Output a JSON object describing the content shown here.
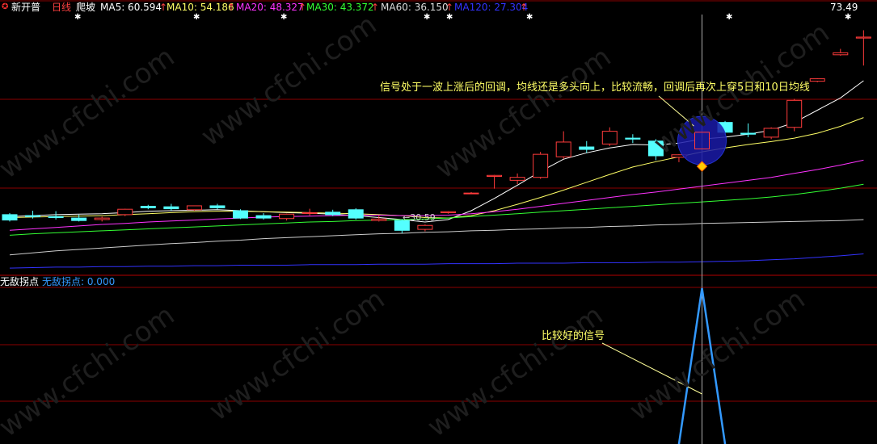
{
  "header": {
    "stock_name": "新开普",
    "period": "日线",
    "formula": "爬坡",
    "ma5": "MA5: 60.594",
    "ma10": "MA10: 54.186",
    "ma20": "MA20: 48.327",
    "ma30": "MA30: 43.372",
    "ma60": "MA60: 36.150",
    "ma120": "MA120: 27.304",
    "up_arrow": "↑",
    "price_label": "73.49"
  },
  "sub_header": {
    "indicator": "无敌拐点",
    "value_label": "无敌拐点: 0.000"
  },
  "annotations": {
    "main_note": "信号处于一波上涨后的回调，均线还是多头向上，比较流畅，回调后再次上穿5日和10日均线",
    "low_label": "←30.59",
    "sub_note": "比较好的信号"
  },
  "watermark": "www.cfchi.com",
  "colors": {
    "up": "#ff3b3b",
    "down": "#54ffff",
    "ma5": "#ffffff",
    "ma10": "#ffff66",
    "ma20": "#ff33ff",
    "ma30": "#33ff33",
    "ma60": "#cccccc",
    "ma120": "#3333ff",
    "signal": "#3399ff",
    "grid": "#8b0000"
  },
  "chart_data": {
    "type": "candlestick",
    "candles": [
      {
        "o": 37.2,
        "c": 36.1,
        "h": 37.5,
        "l": 35.8
      },
      {
        "o": 37.0,
        "c": 36.8,
        "h": 38.0,
        "l": 36.4
      },
      {
        "o": 36.8,
        "c": 36.6,
        "h": 37.9,
        "l": 36.2
      },
      {
        "o": 36.5,
        "c": 36.0,
        "h": 37.2,
        "l": 35.8
      },
      {
        "o": 36.2,
        "c": 36.5,
        "h": 36.8,
        "l": 35.8
      },
      {
        "o": 37.2,
        "c": 38.3,
        "h": 38.4,
        "l": 36.9
      },
      {
        "o": 38.9,
        "c": 38.6,
        "h": 39.2,
        "l": 38.3
      },
      {
        "o": 38.8,
        "c": 38.4,
        "h": 39.4,
        "l": 38.0
      },
      {
        "o": 38.2,
        "c": 39.0,
        "h": 39.0,
        "l": 38.0
      },
      {
        "o": 39.0,
        "c": 38.6,
        "h": 39.4,
        "l": 38.3
      },
      {
        "o": 38.0,
        "c": 36.5,
        "h": 38.3,
        "l": 36.3
      },
      {
        "o": 37.0,
        "c": 36.5,
        "h": 37.5,
        "l": 36.2
      },
      {
        "o": 36.4,
        "c": 37.3,
        "h": 37.4,
        "l": 36.0
      },
      {
        "o": 37.6,
        "c": 37.6,
        "h": 38.4,
        "l": 37.0
      },
      {
        "o": 37.7,
        "c": 37.2,
        "h": 38.2,
        "l": 36.9
      },
      {
        "o": 38.2,
        "c": 36.5,
        "h": 38.5,
        "l": 36.2
      },
      {
        "o": 36.0,
        "c": 36.3,
        "h": 37.0,
        "l": 35.8
      },
      {
        "o": 36.0,
        "c": 34.0,
        "h": 36.3,
        "l": 33.4
      },
      {
        "o": 34.2,
        "c": 35.0,
        "h": 35.2,
        "l": 33.8
      },
      {
        "o": 37.6,
        "c": 37.8,
        "h": 37.9,
        "l": 37.4
      },
      {
        "o": 41.5,
        "c": 41.6,
        "h": 41.8,
        "l": 41.4
      },
      {
        "o": 45.0,
        "c": 45.2,
        "h": 45.3,
        "l": 42.5
      },
      {
        "o": 44.2,
        "c": 44.8,
        "h": 45.6,
        "l": 43.4
      },
      {
        "o": 44.8,
        "c": 49.5,
        "h": 50.0,
        "l": 44.5
      },
      {
        "o": 49.0,
        "c": 52.0,
        "h": 54.2,
        "l": 48.6
      },
      {
        "o": 51.0,
        "c": 50.5,
        "h": 52.2,
        "l": 49.8
      },
      {
        "o": 51.6,
        "c": 54.2,
        "h": 55.0,
        "l": 51.2
      },
      {
        "o": 52.8,
        "c": 52.6,
        "h": 53.6,
        "l": 51.8
      },
      {
        "o": 52.2,
        "c": 49.2,
        "h": 52.6,
        "l": 48.3
      },
      {
        "o": 48.9,
        "c": 49.4,
        "h": 49.5,
        "l": 47.9
      },
      {
        "o": 50.6,
        "c": 54.0,
        "h": 55.0,
        "l": 50.2
      },
      {
        "o": 56.0,
        "c": 54.0,
        "h": 56.3,
        "l": 53.5
      },
      {
        "o": 53.8,
        "c": 53.6,
        "h": 55.8,
        "l": 53.0
      },
      {
        "o": 53.0,
        "c": 54.8,
        "h": 55.0,
        "l": 52.6
      },
      {
        "o": 55.0,
        "c": 60.5,
        "h": 60.8,
        "l": 54.2
      },
      {
        "o": 64.4,
        "c": 64.9,
        "h": 65.0,
        "l": 64.2
      },
      {
        "o": 69.8,
        "c": 70.2,
        "h": 71.0,
        "l": 69.6
      },
      {
        "o": 73.2,
        "c": 73.4,
        "h": 74.8,
        "l": 67.6
      }
    ],
    "ma": {
      "MA5": [
        36.8,
        37.0,
        37.2,
        37.3,
        37.4,
        37.6,
        37.9,
        38.0,
        38.1,
        38.2,
        38.0,
        37.8,
        37.6,
        37.5,
        37.3,
        37.0,
        36.6,
        36.2,
        35.7,
        36.2,
        38.0,
        40.5,
        43.2,
        46.0,
        48.5,
        49.8,
        50.8,
        51.5,
        51.4,
        51.8,
        52.6,
        53.0,
        53.6,
        54.4,
        56.0,
        58.5,
        61.0,
        64.5
      ],
      "MA10": [
        36.6,
        36.7,
        36.8,
        36.9,
        37.0,
        37.2,
        37.4,
        37.6,
        37.8,
        37.9,
        37.9,
        37.8,
        37.7,
        37.6,
        37.5,
        37.4,
        37.2,
        37.0,
        36.6,
        36.5,
        37.0,
        38.0,
        39.3,
        40.7,
        42.2,
        43.8,
        45.4,
        46.9,
        48.0,
        49.0,
        50.0,
        50.8,
        51.5,
        52.1,
        52.8,
        53.8,
        55.2,
        57.0
      ],
      "MA20": [
        34.0,
        34.3,
        34.6,
        34.9,
        35.2,
        35.4,
        35.7,
        35.9,
        36.1,
        36.3,
        36.5,
        36.7,
        36.8,
        36.9,
        37.0,
        37.1,
        37.1,
        37.0,
        37.0,
        37.1,
        37.4,
        37.8,
        38.3,
        38.9,
        39.5,
        40.1,
        40.7,
        41.3,
        41.8,
        42.4,
        43.0,
        43.6,
        44.2,
        44.8,
        45.6,
        46.4,
        47.3,
        48.3
      ],
      "MA30": [
        33.0,
        33.3,
        33.5,
        33.7,
        33.9,
        34.1,
        34.3,
        34.5,
        34.7,
        34.9,
        35.1,
        35.3,
        35.5,
        35.7,
        35.8,
        36.0,
        36.1,
        36.2,
        36.3,
        36.5,
        36.8,
        37.1,
        37.4,
        37.7,
        38.0,
        38.3,
        38.6,
        38.9,
        39.2,
        39.5,
        39.8,
        40.1,
        40.4,
        40.8,
        41.3,
        41.9,
        42.6,
        43.4
      ],
      "MA60": [
        29.0,
        29.4,
        29.8,
        30.1,
        30.4,
        30.7,
        31.0,
        31.3,
        31.5,
        31.8,
        32.0,
        32.3,
        32.5,
        32.7,
        32.9,
        33.1,
        33.3,
        33.4,
        33.6,
        33.7,
        33.9,
        34.0,
        34.2,
        34.3,
        34.5,
        34.6,
        34.8,
        34.9,
        35.1,
        35.2,
        35.4,
        35.5,
        35.6,
        35.7,
        35.8,
        35.9,
        36.0,
        36.2
      ],
      "MA120": [
        26.3,
        26.4,
        26.5,
        26.5,
        26.6,
        26.6,
        26.7,
        26.7,
        26.8,
        26.8,
        26.9,
        26.9,
        26.9,
        27.0,
        27.0,
        27.0,
        27.1,
        27.1,
        27.1,
        27.2,
        27.2,
        27.2,
        27.3,
        27.3,
        27.3,
        27.4,
        27.4,
        27.4,
        27.5,
        27.5,
        27.6,
        27.7,
        27.8,
        28.0,
        28.2,
        28.5,
        28.8,
        29.2
      ]
    },
    "signal": {
      "name": "无敌拐点",
      "values": [
        0,
        0,
        0,
        0,
        0,
        0,
        0,
        0,
        0,
        0,
        0,
        0,
        0,
        0,
        0,
        0,
        0,
        0,
        0,
        0,
        0,
        0,
        0,
        0,
        0,
        0,
        0,
        0,
        0,
        0,
        1,
        0,
        0,
        0,
        0,
        0,
        0,
        0
      ]
    },
    "signal_index": 30,
    "low_index": 17,
    "ylim": [
      25,
      78
    ],
    "grid": true
  }
}
